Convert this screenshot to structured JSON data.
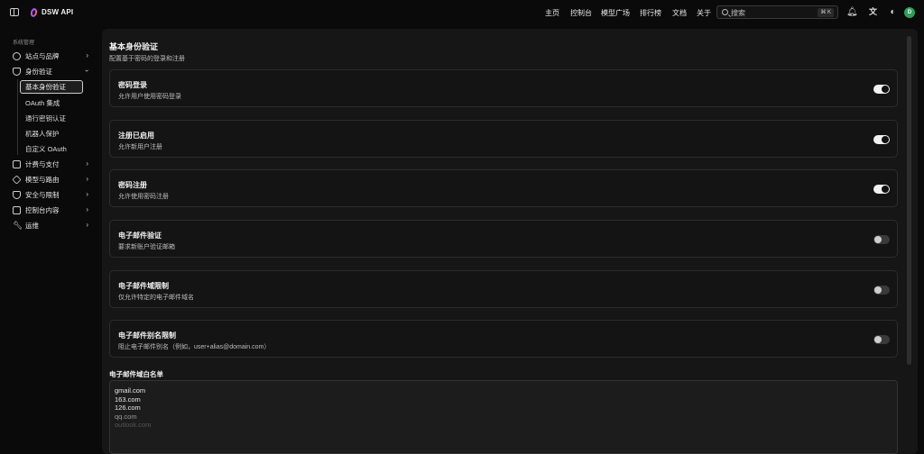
{
  "header": {
    "brand": "DSW API",
    "nav": [
      "主页",
      "控制台",
      "模型广场",
      "排行榜",
      "文档",
      "关于"
    ],
    "search_placeholder": "搜索",
    "search_shortcut": "⌘ K",
    "avatar_letter": "D"
  },
  "sidebar": {
    "section_title": "系统管理",
    "items": [
      {
        "label": "站点与品牌",
        "icon": "gear-icon"
      },
      {
        "label": "身份验证",
        "icon": "shield-icon",
        "expanded": true
      },
      {
        "label": "计费与支付",
        "icon": "card-icon"
      },
      {
        "label": "模型与路由",
        "icon": "cube-icon"
      },
      {
        "label": "安全与限制",
        "icon": "shield-icon"
      },
      {
        "label": "控制台内容",
        "icon": "layout-icon"
      },
      {
        "label": "运维",
        "icon": "wrench-icon"
      }
    ],
    "sub_items": [
      "基本身份验证",
      "OAuth 集成",
      "通行密钥认证",
      "机器人保护",
      "自定义 OAuth"
    ],
    "active_sub": "基本身份验证"
  },
  "main": {
    "title": "基本身份验证",
    "description": "配置基于密码的登录和注册",
    "settings": [
      {
        "title": "密码登录",
        "description": "允许用户使用密码登录",
        "enabled": true
      },
      {
        "title": "注册已启用",
        "description": "允许新用户注册",
        "enabled": true
      },
      {
        "title": "密码注册",
        "description": "允许使用密码注册",
        "enabled": true
      },
      {
        "title": "电子邮件验证",
        "description": "要求新账户验证邮箱",
        "enabled": false
      },
      {
        "title": "电子邮件域限制",
        "description": "仅允许特定的电子邮件域名",
        "enabled": false
      },
      {
        "title": "电子邮件别名限制",
        "description": "阻止电子邮件别名（例如，user+alias@domain.com）",
        "enabled": false
      }
    ],
    "whitelist_label": "电子邮件域白名单",
    "whitelist_domains": [
      "gmail.com",
      "163.com",
      "126.com",
      "qq.com",
      "outlook.com"
    ]
  }
}
